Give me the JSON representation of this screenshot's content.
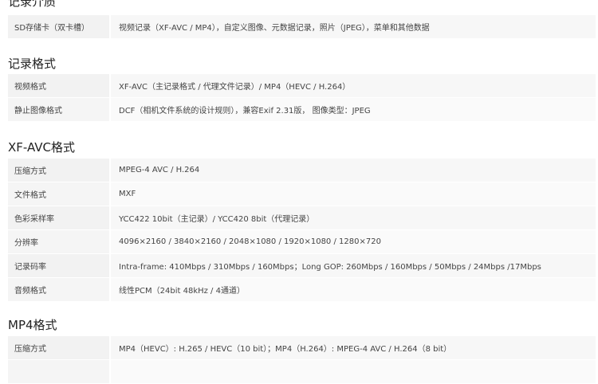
{
  "sections": [
    {
      "title": "记录介质",
      "rows": [
        {
          "key": "SD存储卡（双卡槽）",
          "value": "视频记录（XF-AVC / MP4），自定义图像、元数据记录，照片（JPEG），菜单和其他数据"
        }
      ]
    },
    {
      "title": "记录格式",
      "rows": [
        {
          "key": "视频格式",
          "value": "XF-AVC（主记录格式 / 代理文件记录）/ MP4（HEVC / H.264）"
        },
        {
          "key": "静止图像格式",
          "value": "DCF（相机文件系统的设计规则），兼容Exif 2.31版， 图像类型：JPEG"
        }
      ]
    },
    {
      "title": "XF-AVC格式",
      "rows": [
        {
          "key": "压缩方式",
          "value": "MPEG-4 AVC / H.264"
        },
        {
          "key": "文件格式",
          "value": "MXF"
        },
        {
          "key": "色彩采样率",
          "value": "YCC422 10bit（主记录）/ YCC420 8bit（代理记录）"
        },
        {
          "key": "分辨率",
          "value": "4096×2160 / 3840×2160 / 2048×1080 / 1920×1080 / 1280×720"
        },
        {
          "key": "记录码率",
          "value": "Intra-frame: 410Mbps / 310Mbps / 160Mbps；Long GOP: 260Mbps / 160Mbps / 50Mbps / 24Mbps /17Mbps"
        },
        {
          "key": "音频格式",
          "value": "线性PCM（24bit 48kHz / 4通道）"
        }
      ]
    },
    {
      "title": "MP4格式",
      "rows": [
        {
          "key": "压缩方式",
          "value": "MP4（HEVC）: H.265 / HEVC（10 bit）；MP4（H.264）: MPEG-4 AVC / H.264（8 bit）"
        },
        {
          "key": "",
          "value": ""
        }
      ]
    }
  ]
}
